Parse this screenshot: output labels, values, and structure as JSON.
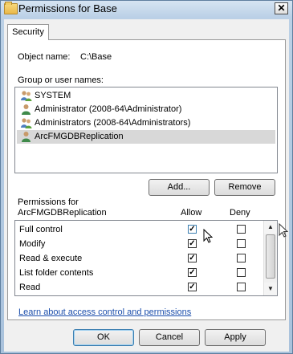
{
  "window": {
    "title": "Permissions for Base",
    "close_glyph": "✕"
  },
  "tabs": [
    {
      "label": "Security"
    }
  ],
  "object": {
    "label": "Object name:",
    "value": "C:\\Base"
  },
  "groups": {
    "label": "Group or user names:",
    "items": [
      {
        "name": "SYSTEM",
        "icon": "group-users-icon",
        "selected": false
      },
      {
        "name": "Administrator (2008-64\\Administrator)",
        "icon": "user-icon",
        "selected": false
      },
      {
        "name": "Administrators (2008-64\\Administrators)",
        "icon": "group-users-icon",
        "selected": false
      },
      {
        "name": "ArcFMGDBReplication",
        "icon": "user-icon",
        "selected": true
      }
    ],
    "add_label": "Add...",
    "remove_label": "Remove"
  },
  "permissions": {
    "label_line1": "Permissions for",
    "label_line2": "ArcFMGDBReplication",
    "allow_header": "Allow",
    "deny_header": "Deny",
    "rows": [
      {
        "name": "Full control",
        "allow": true,
        "deny": false
      },
      {
        "name": "Modify",
        "allow": true,
        "deny": false
      },
      {
        "name": "Read & execute",
        "allow": true,
        "deny": false
      },
      {
        "name": "List folder contents",
        "allow": true,
        "deny": false
      },
      {
        "name": "Read",
        "allow": true,
        "deny": false
      }
    ]
  },
  "link": "Learn about access control and permissions",
  "buttons": {
    "ok": "OK",
    "cancel": "Cancel",
    "apply": "Apply"
  },
  "colors": {
    "selection": "#d8d8d8",
    "link": "#1a4dab",
    "title_gradient_top": "#d6e4f2"
  }
}
